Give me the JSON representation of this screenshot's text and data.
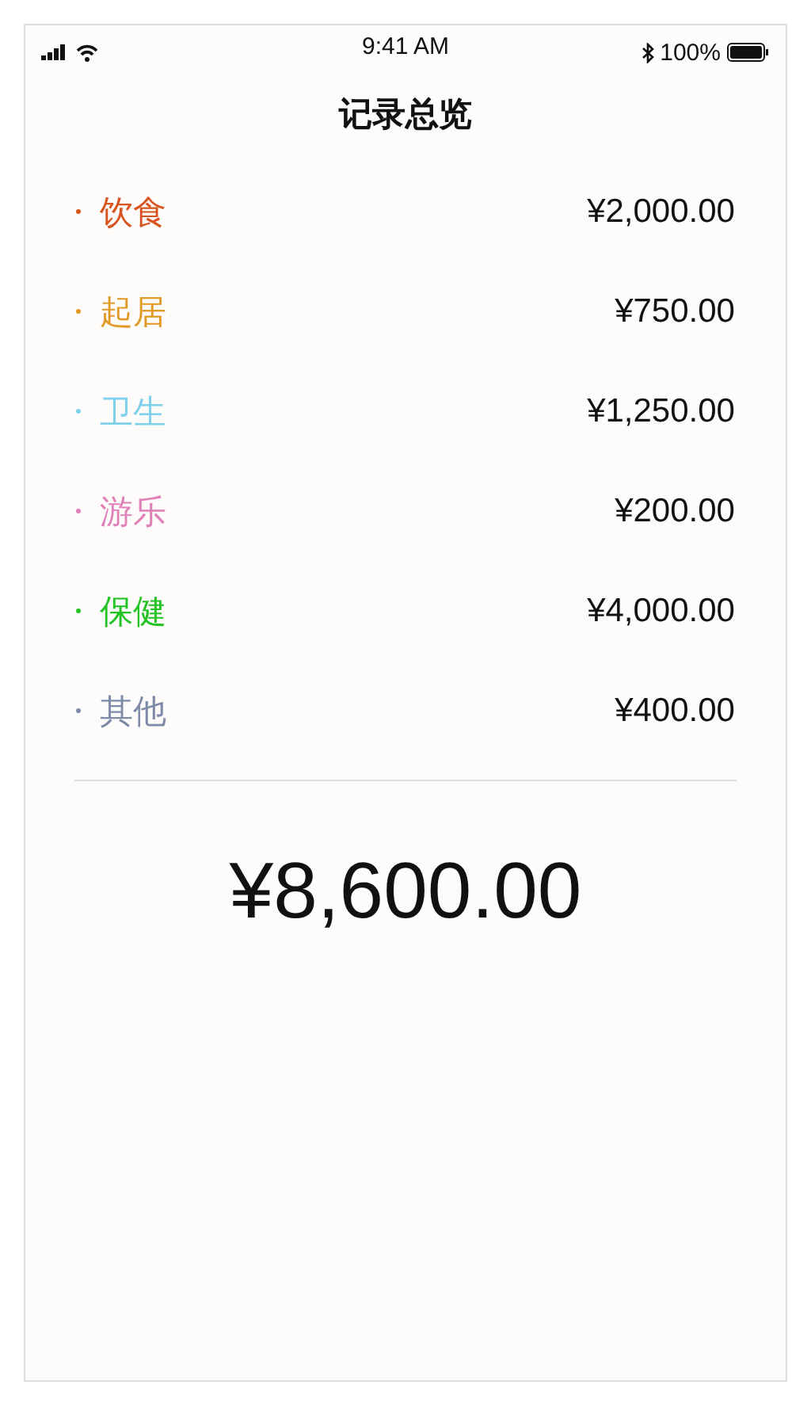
{
  "status_bar": {
    "time": "9:41 AM",
    "battery": "100%"
  },
  "title": "记录总览",
  "categories": [
    {
      "label": "饮食",
      "amount": "¥2,000.00",
      "color": "#d9531e"
    },
    {
      "label": "起居",
      "amount": "¥750.00",
      "color": "#e09a26"
    },
    {
      "label": "卫生",
      "amount": "¥1,250.00",
      "color": "#7fd0ea"
    },
    {
      "label": "游乐",
      "amount": "¥200.00",
      "color": "#e07fb8"
    },
    {
      "label": "保健",
      "amount": "¥4,000.00",
      "color": "#22c322"
    },
    {
      "label": "其他",
      "amount": "¥400.00",
      "color": "#7d8aa8"
    }
  ],
  "total": "¥8,600.00"
}
